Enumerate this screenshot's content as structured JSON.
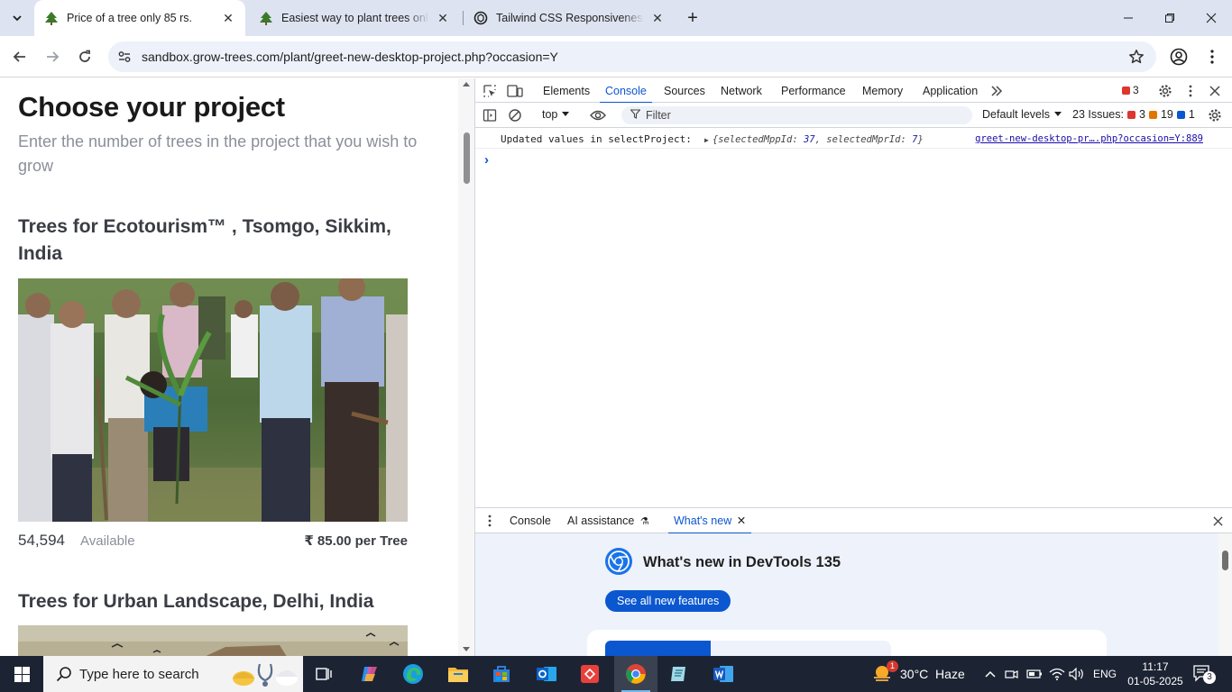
{
  "browser": {
    "tabs": [
      {
        "title": "Price of a tree only 85 rs.",
        "active": true
      },
      {
        "title": "Easiest way to plant trees online",
        "active": false
      },
      {
        "title": "Tailwind CSS Responsiveness Help",
        "active": false
      }
    ],
    "url": "sandbox.grow-trees.com/plant/greet-new-desktop-project.php?occasion=Y"
  },
  "page": {
    "title": "Choose your project",
    "subtitle": "Enter the number of trees in the project that you wish to grow",
    "projects": [
      {
        "title": "Trees for Ecotourism™ , Tsomgo, Sikkim, India",
        "count": "54,594",
        "available_label": "Available",
        "price": "₹ 85.00 per Tree"
      },
      {
        "title": "Trees for Urban Landscape, Delhi, India"
      }
    ]
  },
  "devtools": {
    "tabs": [
      "Elements",
      "Console",
      "Sources",
      "Network",
      "Performance",
      "Memory",
      "Application"
    ],
    "active_tab": "Console",
    "error_count": "3",
    "context": "top",
    "filter_placeholder": "Filter",
    "levels": "Default levels",
    "issues": {
      "label": "23 Issues:",
      "errors": "3",
      "warnings": "19",
      "info": "1"
    },
    "log": {
      "message": "Updated values in selectProject:",
      "object_prefix": "{selectedMppId: ",
      "mpp_id": "37",
      "object_mid": ", selectedMprId: ",
      "mpr_id": "7",
      "object_suffix": "}",
      "source": "greet-new-desktop-pr….php?occasion=Y:889"
    },
    "drawer": {
      "tabs": [
        "Console",
        "AI assistance",
        "What's new"
      ],
      "active_tab": "What's new"
    },
    "whats_new": {
      "title": "What's new in DevTools 135",
      "button": "See all new features"
    }
  },
  "taskbar": {
    "search_placeholder": "Type here to search",
    "weather": "30°C  Haze",
    "weather_badge": "1",
    "language": "ENG",
    "time": "11:17",
    "date": "01-05-2025",
    "notifications": "3"
  },
  "colors": {
    "accent": "#0b57d0",
    "tabstrip": "#dee3f1",
    "taskbar": "#1c2434"
  }
}
